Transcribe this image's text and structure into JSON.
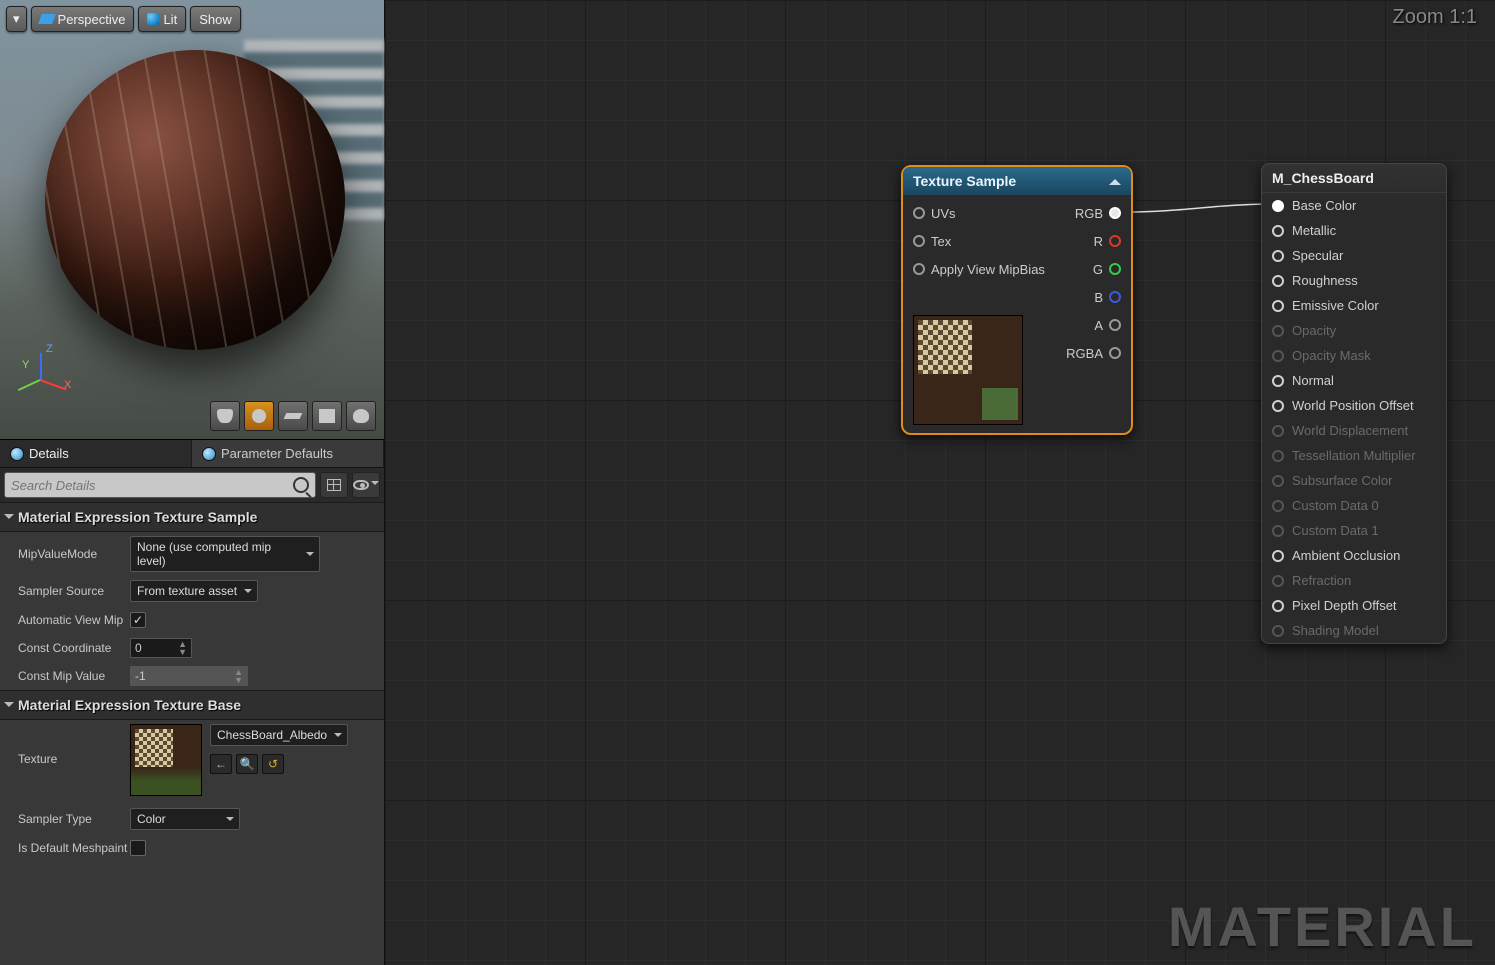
{
  "viewport": {
    "toolbar": {
      "perspective": "Perspective",
      "lit": "Lit",
      "show": "Show"
    },
    "axis": {
      "x": "X",
      "y": "Y",
      "z": "Z"
    }
  },
  "tabs": {
    "details": "Details",
    "parameterDefaults": "Parameter Defaults"
  },
  "search": {
    "placeholder": "Search Details"
  },
  "sections": {
    "textureSample": {
      "title": "Material Expression Texture Sample",
      "props": {
        "mipValueMode": {
          "label": "MipValueMode",
          "value": "None (use computed mip level)"
        },
        "samplerSource": {
          "label": "Sampler Source",
          "value": "From texture asset"
        },
        "autoViewMip": {
          "label": "Automatic View Mip",
          "checked": true
        },
        "constCoord": {
          "label": "Const Coordinate",
          "value": "0"
        },
        "constMip": {
          "label": "Const Mip Value",
          "value": "-1"
        }
      }
    },
    "textureBase": {
      "title": "Material Expression Texture Base",
      "props": {
        "texture": {
          "label": "Texture",
          "assetName": "ChessBoard_Albedo"
        },
        "samplerType": {
          "label": "Sampler Type",
          "value": "Color"
        },
        "isDefaultMeshpaint": {
          "label": "Is Default Meshpaint",
          "checked": false
        }
      }
    }
  },
  "graph": {
    "zoom": "Zoom 1:1",
    "watermark": "MATERIAL",
    "textureSampleNode": {
      "title": "Texture Sample",
      "inputs": {
        "uvs": "UVs",
        "tex": "Tex",
        "mipbias": "Apply View MipBias"
      },
      "outputs": {
        "rgb": "RGB",
        "r": "R",
        "g": "G",
        "b": "B",
        "a": "A",
        "rgba": "RGBA"
      }
    },
    "outputNode": {
      "title": "M_ChessBoard",
      "pins": [
        {
          "label": "Base Color",
          "enabled": true,
          "connected": true
        },
        {
          "label": "Metallic",
          "enabled": true
        },
        {
          "label": "Specular",
          "enabled": true
        },
        {
          "label": "Roughness",
          "enabled": true
        },
        {
          "label": "Emissive Color",
          "enabled": true
        },
        {
          "label": "Opacity",
          "enabled": false
        },
        {
          "label": "Opacity Mask",
          "enabled": false
        },
        {
          "label": "Normal",
          "enabled": true
        },
        {
          "label": "World Position Offset",
          "enabled": true
        },
        {
          "label": "World Displacement",
          "enabled": false
        },
        {
          "label": "Tessellation Multiplier",
          "enabled": false
        },
        {
          "label": "Subsurface Color",
          "enabled": false
        },
        {
          "label": "Custom Data 0",
          "enabled": false
        },
        {
          "label": "Custom Data 1",
          "enabled": false
        },
        {
          "label": "Ambient Occlusion",
          "enabled": true
        },
        {
          "label": "Refraction",
          "enabled": false
        },
        {
          "label": "Pixel Depth Offset",
          "enabled": true
        },
        {
          "label": "Shading Model",
          "enabled": false
        }
      ]
    }
  }
}
